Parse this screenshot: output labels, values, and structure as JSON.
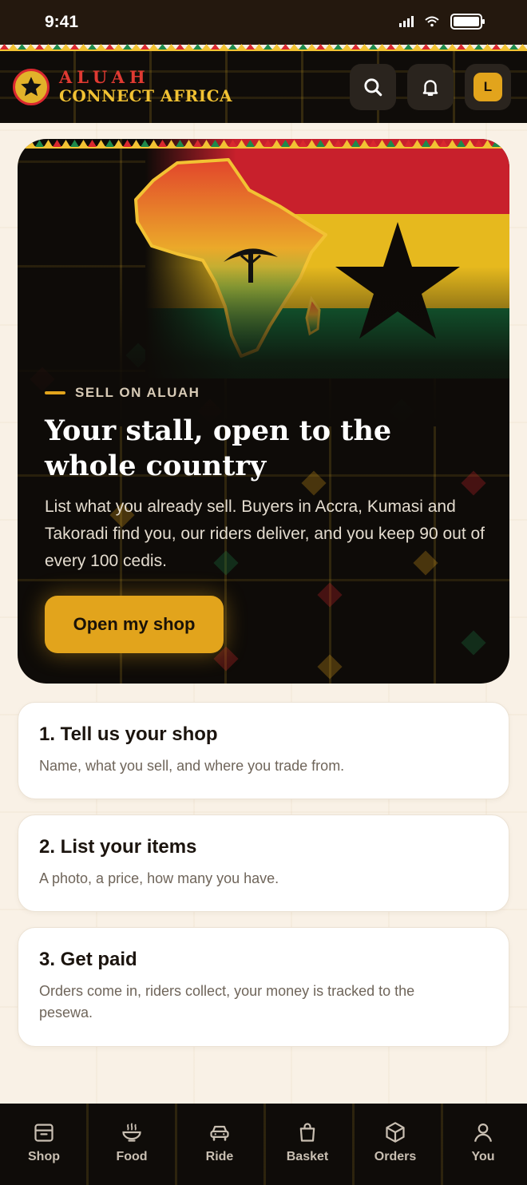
{
  "status_bar": {
    "time": "9:41"
  },
  "header": {
    "brand_line1": "ALUAH",
    "brand_line2": "CONNECT AFRICA",
    "avatar_initial": "L"
  },
  "hero": {
    "eyebrow": "SELL ON ALUAH",
    "title": "Your stall, open to the whole country",
    "body": "List what you already sell. Buyers in Accra, Kumasi and Takoradi find you, our riders deliver, and you keep 90 out of every 100 cedis.",
    "cta_label": "Open my shop"
  },
  "steps": [
    {
      "title": "1. Tell us your shop",
      "desc": "Name, what you sell, and where you trade from."
    },
    {
      "title": "2. List your items",
      "desc": "A photo, a price, how many you have."
    },
    {
      "title": "3. Get paid",
      "desc": "Orders come in, riders collect, your money is tracked to the pesewa."
    }
  ],
  "nav": [
    {
      "label": "Shop",
      "icon": "shop-icon"
    },
    {
      "label": "Food",
      "icon": "food-bowl-icon"
    },
    {
      "label": "Ride",
      "icon": "car-icon"
    },
    {
      "label": "Basket",
      "icon": "basket-bag-icon"
    },
    {
      "label": "Orders",
      "icon": "box-icon"
    },
    {
      "label": "You",
      "icon": "person-icon"
    }
  ],
  "colors": {
    "accent": "#e2a41c",
    "ghana_red": "#d9282f",
    "ghana_gold": "#f2c233",
    "ghana_green": "#1e8a4b",
    "dark": "#0f0c09"
  }
}
